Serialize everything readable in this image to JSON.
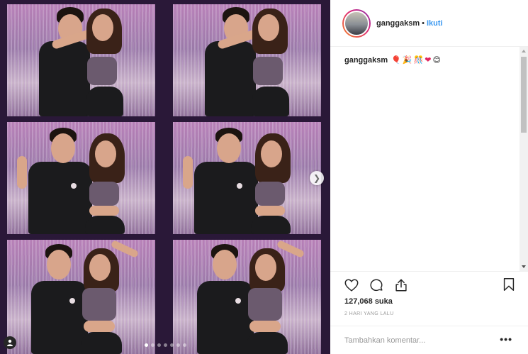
{
  "post": {
    "username": "ganggaksm",
    "separator": "•",
    "follow_label": "Ikuti",
    "caption_username": "ganggaksm",
    "caption_emojis": [
      "🎈",
      "🎉",
      "🎊",
      "❤",
      "😊"
    ],
    "likes": "127,068 suka",
    "time_ago": "2 HARI YANG LALU",
    "comment_placeholder": "Tambahkan komentar...",
    "more_label": "•••",
    "carousel": {
      "total_slides": 7,
      "active_slide": 1
    }
  },
  "icons": {
    "like": "heart-icon",
    "comment": "comment-bubble-icon",
    "share": "share-icon",
    "save": "bookmark-icon",
    "next": "chevron-right-icon",
    "tag": "user-tag-icon"
  },
  "colors": {
    "accent": "#3897f0",
    "text": "#262626",
    "muted": "#999999",
    "border": "#efefef"
  }
}
